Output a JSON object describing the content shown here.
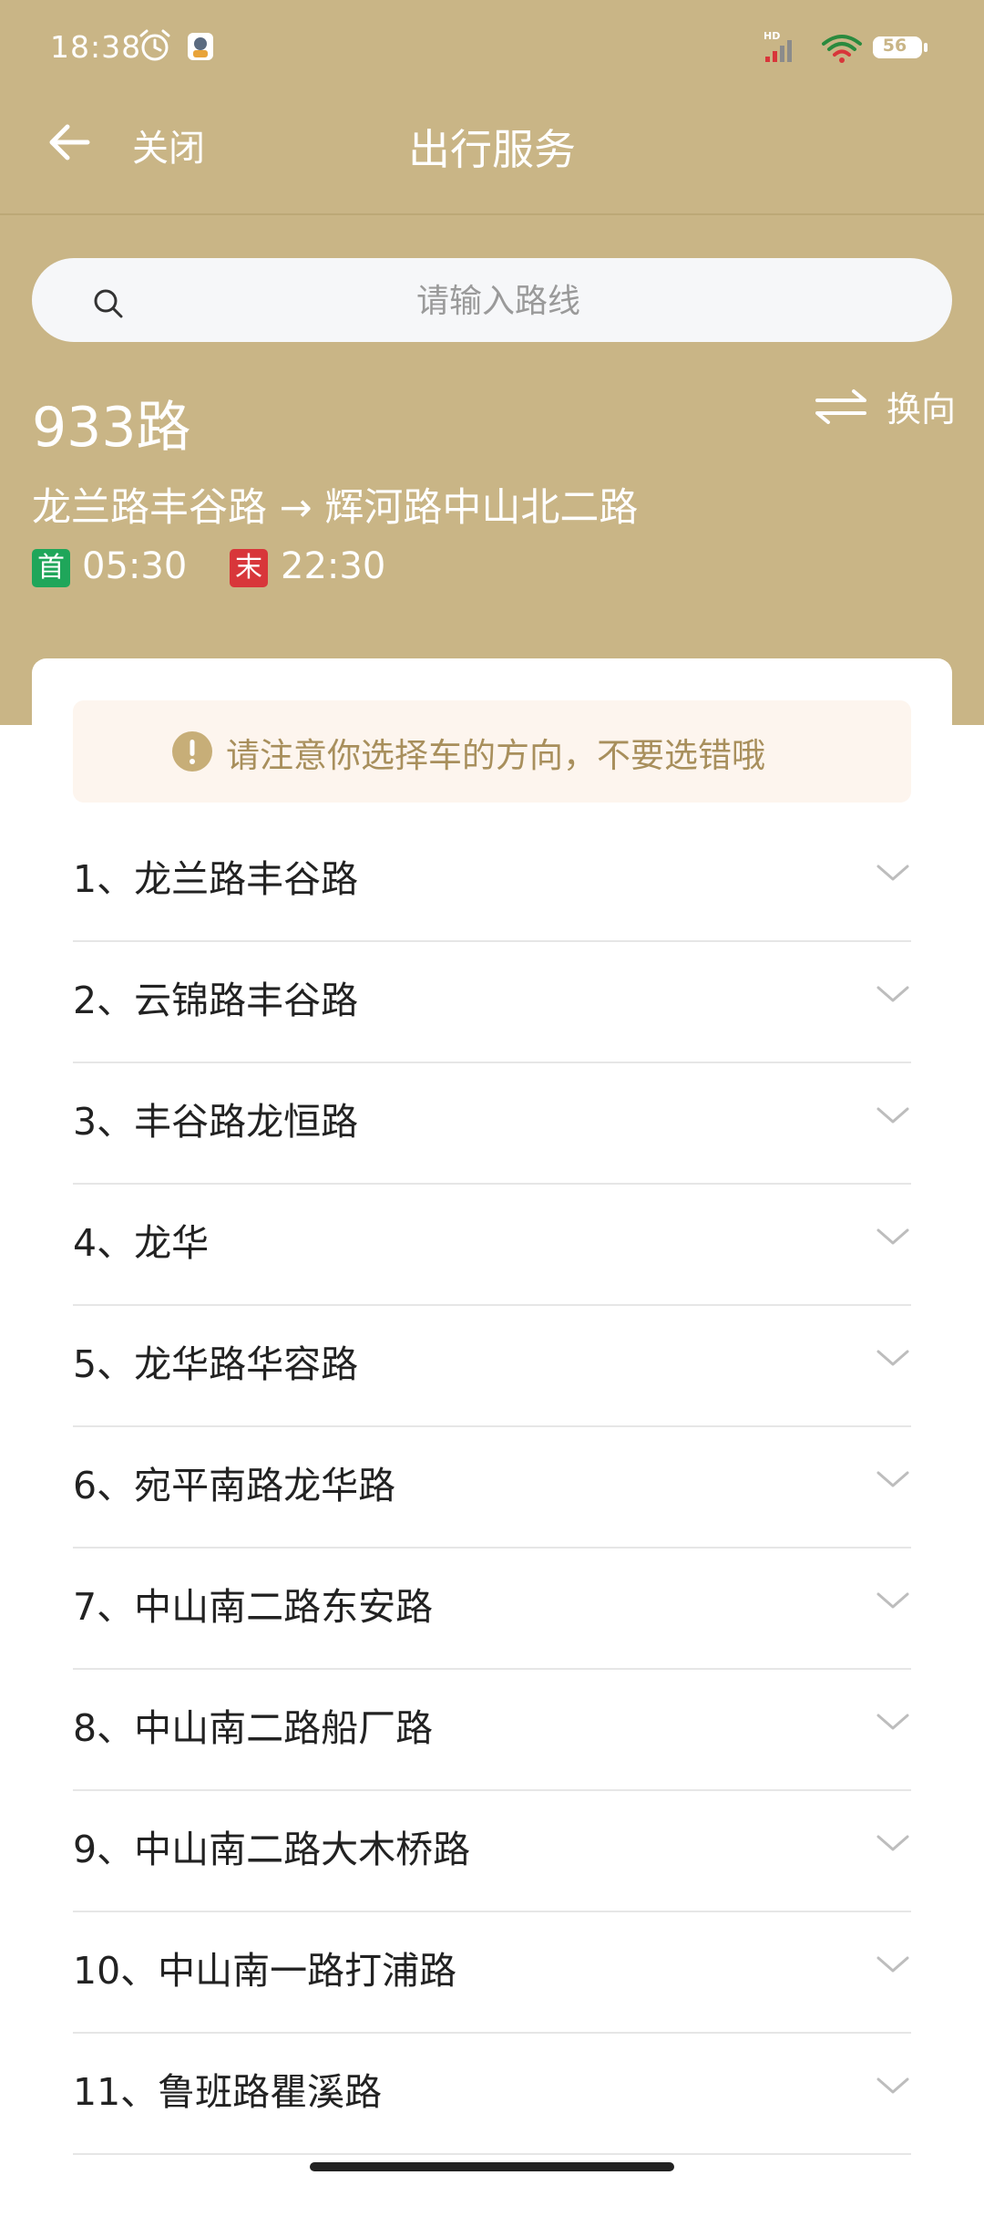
{
  "status_bar": {
    "time": "18:38",
    "battery": "56",
    "icons": [
      "alarm-icon",
      "app-notification-icon",
      "hd-signal-icon",
      "wifi-icon",
      "battery-icon"
    ]
  },
  "header": {
    "close_label": "关闭",
    "title": "出行服务"
  },
  "search": {
    "placeholder": "请输入路线",
    "value": ""
  },
  "route": {
    "number": "933路",
    "swap_label": "换向",
    "direction": "龙兰路丰谷路 → 辉河路中山北二路",
    "first_badge": "首",
    "first_time": "05:30",
    "last_badge": "末",
    "last_time": "22:30"
  },
  "notice": {
    "text": "请注意你选择车的方向，不要选错哦"
  },
  "stops": [
    "1、龙兰路丰谷路",
    "2、云锦路丰谷路",
    "3、丰谷路龙恒路",
    "4、龙华",
    "5、龙华路华容路",
    "6、宛平南路龙华路",
    "7、中山南二路东安路",
    "8、中山南二路船厂路",
    "9、中山南二路大木桥路",
    "10、中山南一路打浦路",
    "11、鲁班路瞿溪路"
  ],
  "colors": {
    "header_background": "#C9B586",
    "notice_background": "#FDF5EE",
    "notice_text": "#A88F5C",
    "first_badge": "#1FA65A",
    "last_badge": "#D8363A"
  }
}
